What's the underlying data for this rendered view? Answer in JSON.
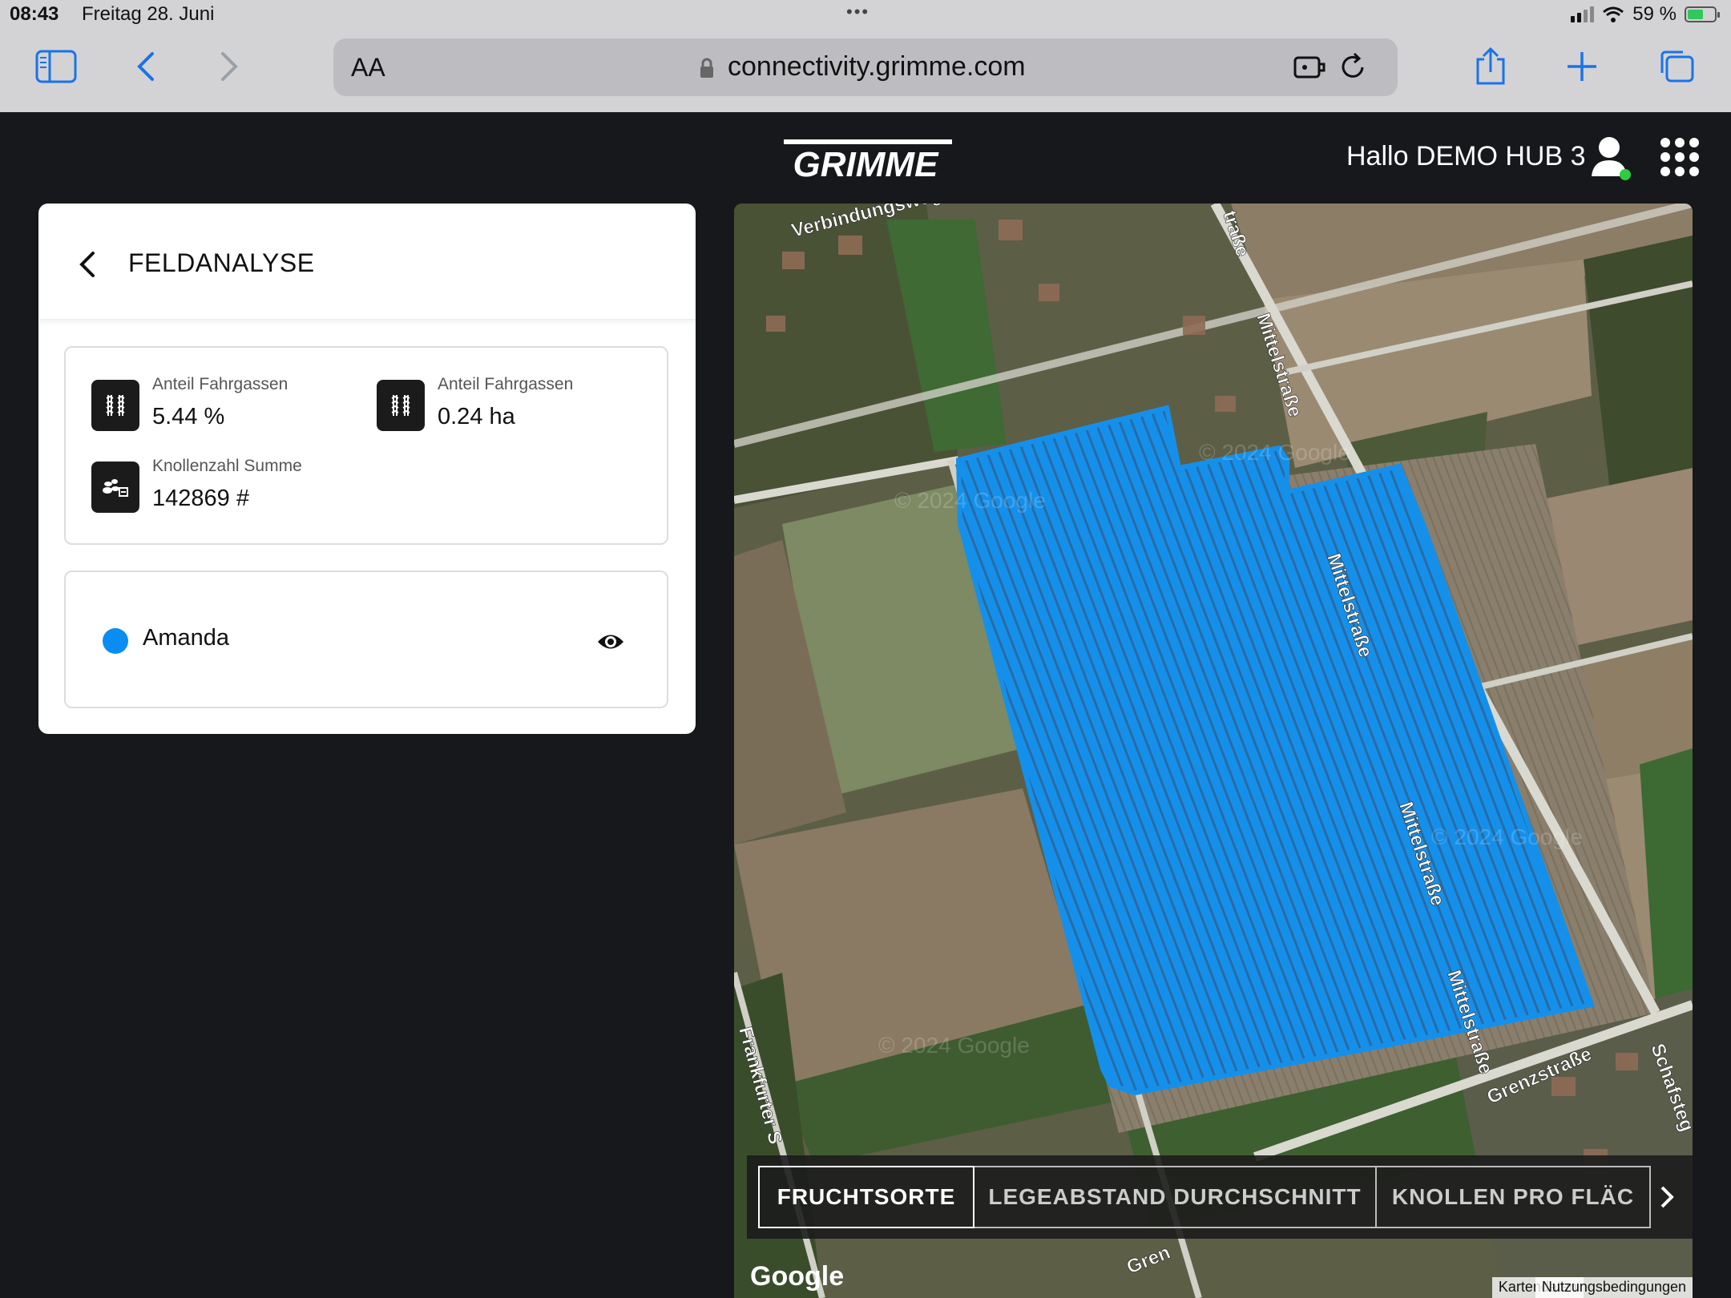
{
  "status": {
    "time": "08:43",
    "date": "Freitag 28. Juni",
    "battery": "59 %",
    "battery_level": 0.59
  },
  "browser": {
    "text_size_label": "AA",
    "url": "connectivity.grimme.com"
  },
  "header": {
    "logo_text": "GRIMME",
    "greeting": "Hallo DEMO HUB 3"
  },
  "panel": {
    "title": "FELDANALYSE",
    "metrics": [
      {
        "label": "Anteil Fahrgassen",
        "value": "5.44 %",
        "icon": "tramline-icon"
      },
      {
        "label": "Anteil Fahrgassen",
        "value": "0.24 ha",
        "icon": "tramline-icon"
      },
      {
        "label": "Knollenzahl Summe",
        "value": "142869 #",
        "icon": "tubers-icon"
      }
    ],
    "layer": {
      "name": "Amanda",
      "color": "#0a8df2"
    }
  },
  "map": {
    "streets": [
      "Verbindungsweg",
      "traße",
      "Mittelstraße",
      "Mittelstraße",
      "Mittelstraße",
      "Mittelstraße",
      "Frankfurter S",
      "Grenzstraße",
      "Schafsteg",
      "Gren"
    ],
    "watermark": "© 2024 Google",
    "tabs": [
      "FRUCHTSORTE",
      "LEGEABSTAND DURCHSCHNITT",
      "KNOLLEN PRO FLÄC"
    ],
    "active_tab": "FRUCHTSORTE",
    "google_logo": "Google",
    "attribution": {
      "data": "Kartendaten",
      "terms": "Nutzungsbedingungen"
    },
    "colors": {
      "field": "#1590ea"
    }
  }
}
